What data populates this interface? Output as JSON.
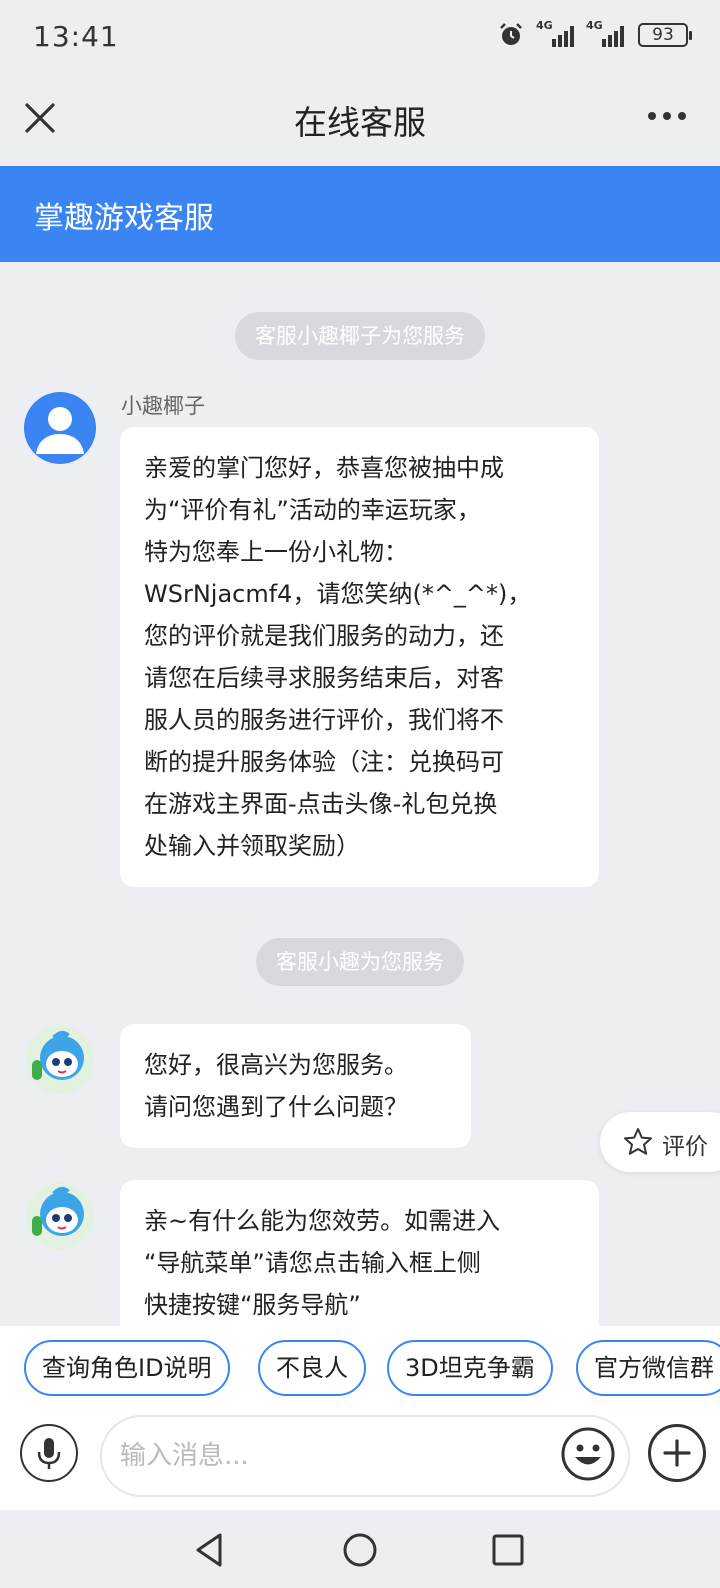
{
  "status_bar": {
    "time": "13:41",
    "battery": "93",
    "network1": "4G",
    "network2": "4G"
  },
  "nav": {
    "title": "在线客服",
    "close_icon": "close-icon",
    "more_icon": "more-icon"
  },
  "header": {
    "title": "掌趣游戏客服"
  },
  "chat": {
    "notice1": "客服小趣椰子为您服务",
    "msg1": {
      "sender": "小趣椰子",
      "lines": [
        "亲爱的掌门您好，恭喜您被抽中成",
        "为“评价有礼”活动的幸运玩家，",
        "特为您奉上一份小礼物：",
        "WSrNjacmf4，请您笑纳(*^_^*)，",
        "您的评价就是我们服务的动力，还",
        "请您在后续寻求服务结束后，对客",
        "服人员的服务进行评价，我们将不",
        "断的提升服务体验（注：兑换码可",
        "在游戏主界面-点击头像-礼包兑换",
        "处输入并领取奖励）"
      ]
    },
    "notice2": "客服小趣为您服务",
    "msg2": {
      "lines": [
        "您好，很高兴为您服务。",
        "请问您遇到了什么问题？"
      ]
    },
    "msg3": {
      "lines": [
        "亲~有什么能为您效劳。如需进入",
        "“导航菜单”请您点击输入框上侧",
        "快捷按键“服务导航”"
      ]
    }
  },
  "rate": {
    "label": "评价"
  },
  "quick_replies": [
    "查询角色ID说明",
    "不良人",
    "3D坦克争霸",
    "官方微信群"
  ],
  "input": {
    "placeholder": "输入消息..."
  },
  "colors": {
    "accent": "#3a85f3",
    "background": "#eceef2"
  }
}
